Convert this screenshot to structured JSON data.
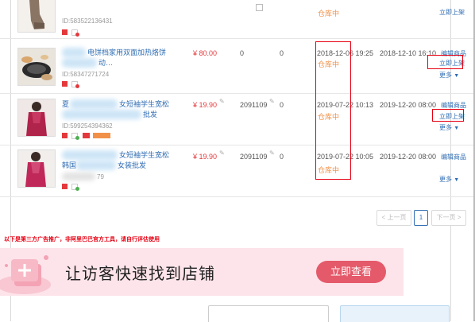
{
  "rows": [
    {
      "id_text": "ID:583522136431",
      "status": "仓库中",
      "action": "立即上架"
    },
    {
      "title_line1": "电饼档家用双面加热烙饼",
      "title_line2": "动…",
      "id_text": "ID:58347271724",
      "price": "¥ 80.00",
      "stock": "0",
      "sales": "0",
      "created": "2018-12-06 19:25",
      "status": "仓库中",
      "modified": "2018-12-10 16:10",
      "edit": "编辑商品",
      "action": "立即上架",
      "more": "更多"
    },
    {
      "title_line1": "夏",
      "title_line2": "女短袖学生宽松",
      "title_line3": "批发",
      "id_text": "ID:599254394362",
      "price": "¥ 19.90",
      "stock": "2091109",
      "sales": "0",
      "created": "2019-07-22 10:13",
      "status": "仓库中",
      "modified": "2019-12-20 08:00",
      "edit": "编辑商品",
      "action": "立即上架",
      "more": "更多"
    },
    {
      "title_line1": "女短袖学生宽松",
      "title_line2": "韩国",
      "title_line3": "女装批发",
      "id_text": "79",
      "price": "¥ 19.90",
      "stock": "2091109",
      "sales": "0",
      "created": "2019-07-22 10:05",
      "status": "仓库中",
      "modified": "2019-12-20 08:00",
      "edit": "编辑商品",
      "more": "更多"
    }
  ],
  "pager": {
    "prev": "< 上一页",
    "page": "1",
    "next": "下一页 >"
  },
  "ad_notice": "以下是第三方广告推广，非阿里巴巴官方工具，请自行评估使用",
  "banner": {
    "text": "让访客快速找到店铺",
    "button": "立即查看"
  },
  "colors": {
    "link": "#2f6db3",
    "price": "#e4393c",
    "status": "#f19149",
    "highlight": "#e60012",
    "banner_bg": "#fde4ea",
    "banner_button": "#e45a6a"
  }
}
